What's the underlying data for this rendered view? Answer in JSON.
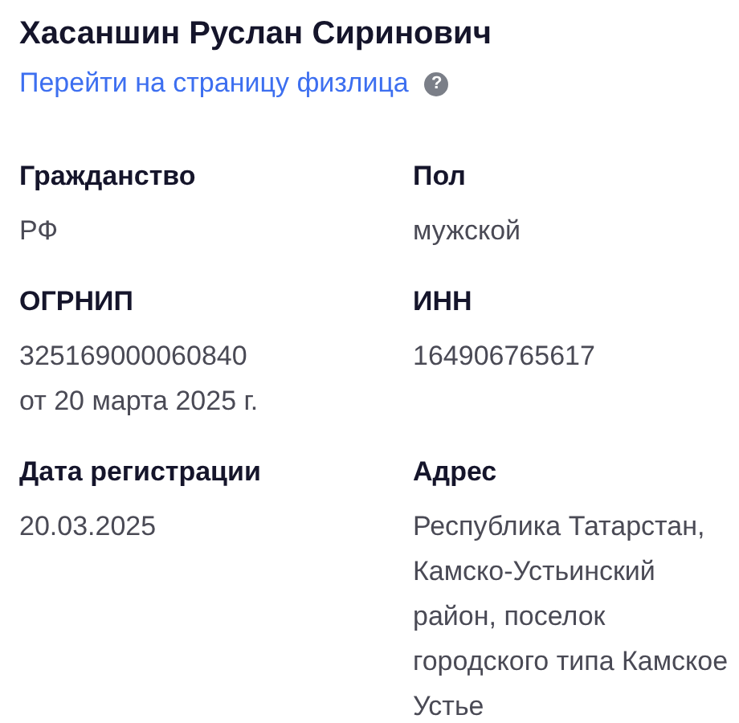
{
  "person": {
    "name": "Хасаншин Руслан Сиринович",
    "link": "Перейти на страницу физлица",
    "help": "?"
  },
  "fields": [
    {
      "label": "Гражданство",
      "value": "РФ"
    },
    {
      "label": "Пол",
      "value": "мужской"
    },
    {
      "label": "ОГРНИП",
      "value": "325169000060840\nот 20 марта 2025 г."
    },
    {
      "label": "ИНН",
      "value": "164906765617"
    },
    {
      "label": "Дата регистрации",
      "value": "20.03.2025"
    },
    {
      "label": "Адрес",
      "value": "Республика Татарстан, Камско-Устьинский район, поселок городского типа Камское Устье"
    }
  ]
}
